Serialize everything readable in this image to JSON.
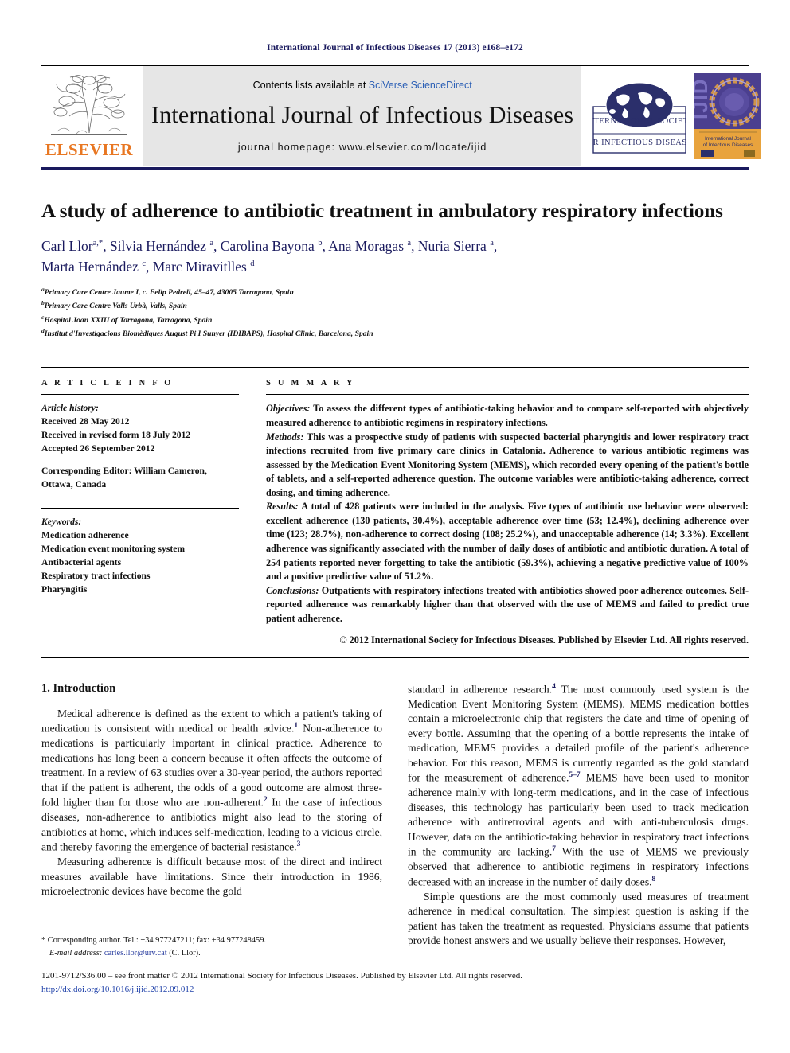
{
  "running_head": "International Journal of Infectious Diseases 17 (2013) e168–e172",
  "masthead": {
    "elsevier_wordmark": "ELSEVIER",
    "contents_prefix": "Contents lists available at ",
    "sciencedirect_link": "SciVerse ScienceDirect",
    "journal_title": "International Journal of Infectious Diseases",
    "homepage_line": "journal homepage: www.elsevier.com/locate/ijid",
    "isid_line1": "INTERNATIONAL SOCIETY",
    "isid_line2": "FOR INFECTIOUS DISEASES",
    "cover_spine": "IJID",
    "cover_title_line1": "International Journal",
    "cover_title_line2": "of Infectious Diseases",
    "accent_orange": "#E87722",
    "accent_navy": "#1a1a5e",
    "band_gray": "#e6e6e6"
  },
  "article": {
    "title": "A study of adherence to antibiotic treatment in ambulatory respiratory infections",
    "authors_line1_html": "Carl Llor<sup>a,*</sup>, Silvia Hernández <sup>a</sup>, Carolina Bayona <sup>b</sup>, Ana Moragas <sup>a</sup>, Nuria Sierra <sup>a</sup>,",
    "authors_line2_html": "Marta Hernández <sup>c</sup>, Marc Miravitlles <sup>d</sup>",
    "affiliations": [
      "Primary Care Centre Jaume I, c. Felip Pedrell, 45–47, 43005 Tarragona, Spain",
      "Primary Care Centre Valls Urbà, Valls, Spain",
      "Hospital Joan XXIII of Tarragona, Tarragona, Spain",
      "Institut d'Investigacions Biomèdiques August Pi I Sunyer (IDIBAPS), Hospital Clinic, Barcelona, Spain"
    ],
    "affiliation_markers": [
      "a",
      "b",
      "c",
      "d"
    ]
  },
  "article_info": {
    "heading": "A R T I C L E   I N F O",
    "history_label": "Article history:",
    "history": [
      "Received 28 May 2012",
      "Received in revised form 18 July 2012",
      "Accepted 26 September 2012"
    ],
    "corresponding_editor_label": "Corresponding Editor:",
    "corresponding_editor_value": " William Cameron, Ottawa, Canada",
    "keywords_label": "Keywords:",
    "keywords": [
      "Medication adherence",
      "Medication event monitoring system",
      "Antibacterial agents",
      "Respiratory tract infections",
      "Pharyngitis"
    ]
  },
  "summary": {
    "heading": "S U M M A R Y",
    "objectives_label": "Objectives:",
    "objectives_text": " To assess the different types of antibiotic-taking behavior and to compare self-reported with objectively measured adherence to antibiotic regimens in respiratory infections.",
    "methods_label": "Methods:",
    "methods_text": " This was a prospective study of patients with suspected bacterial pharyngitis and lower respiratory tract infections recruited from five primary care clinics in Catalonia. Adherence to various antibiotic regimens was assessed by the Medication Event Monitoring System (MEMS), which recorded every opening of the patient's bottle of tablets, and a self-reported adherence question. The outcome variables were antibiotic-taking adherence, correct dosing, and timing adherence.",
    "results_label": "Results:",
    "results_text": " A total of 428 patients were included in the analysis. Five types of antibiotic use behavior were observed: excellent adherence (130 patients, 30.4%), acceptable adherence over time (53; 12.4%), declining adherence over time (123; 28.7%), non-adherence to correct dosing (108; 25.2%), and unacceptable adherence (14; 3.3%). Excellent adherence was significantly associated with the number of daily doses of antibiotic and antibiotic duration. A total of 254 patients reported never forgetting to take the antibiotic (59.3%), achieving a negative predictive value of 100% and a positive predictive value of 51.2%.",
    "conclusions_label": "Conclusions:",
    "conclusions_text": " Outpatients with respiratory infections treated with antibiotics showed poor adherence outcomes. Self-reported adherence was remarkably higher than that observed with the use of MEMS and failed to predict true patient adherence.",
    "copyright": "© 2012 International Society for Infectious Diseases. Published by Elsevier Ltd. All rights reserved."
  },
  "body": {
    "section_heading": "1. Introduction",
    "left_p1_a": "Medical adherence is defined as the extent to which a patient's taking of medication is consistent with medical or health advice.",
    "left_p1_ref1": "1",
    "left_p1_b": " Non-adherence to medications is particularly important in clinical practice. Adherence to medications has long been a concern because it often affects the outcome of treatment. In a review of 63 studies over a 30-year period, the authors reported that if the patient is adherent, the odds of a good outcome are almost three-fold higher than for those who are non-adherent.",
    "left_p1_ref2": "2",
    "left_p1_c": " In the case of infectious diseases, non-adherence to antibiotics might also lead to the storing of antibiotics at home, which induces self-medication, leading to a vicious circle, and thereby favoring the emergence of bacterial resistance.",
    "left_p1_ref3": "3",
    "left_p2": "Measuring adherence is difficult because most of the direct and indirect measures available have limitations. Since their introduction in 1986, microelectronic devices have become the gold",
    "right_p1_a": "standard in adherence research.",
    "right_p1_ref4": "4",
    "right_p1_b": " The most commonly used system is the Medication Event Monitoring System (MEMS). MEMS medication bottles contain a microelectronic chip that registers the date and time of opening of every bottle. Assuming that the opening of a bottle represents the intake of medication, MEMS provides a detailed profile of the patient's adherence behavior. For this reason, MEMS is currently regarded as the gold standard for the measurement of adherence.",
    "right_p1_ref57": "5–7",
    "right_p1_c": " MEMS have been used to monitor adherence mainly with long-term medications, and in the case of infectious diseases, this technology has particularly been used to track medication adherence with antiretroviral agents and with anti-tuberculosis drugs. However, data on the antibiotic-taking behavior in respiratory tract infections in the community are lacking.",
    "right_p1_ref7": "7",
    "right_p1_d": " With the use of MEMS we previously observed that adherence to antibiotic regimens in respiratory infections decreased with an increase in the number of daily doses.",
    "right_p1_ref8": "8",
    "right_p2": "Simple questions are the most commonly used measures of treatment adherence in medical consultation. The simplest question is asking if the patient has taken the treatment as requested. Physicians assume that patients provide honest answers and we usually believe their responses. However,"
  },
  "footnote": {
    "marker": "*",
    "corresponding_text": " Corresponding author. Tel.: +34 977247211; fax: +34 977248459.",
    "email_label": "E-mail address:",
    "email_value": "carles.llor@urv.cat",
    "email_suffix": " (C. Llor)."
  },
  "footer": {
    "front_matter": "1201-9712/$36.00 – see front matter © 2012 International Society for Infectious Diseases. Published by Elsevier Ltd. All rights reserved.",
    "doi": "http://dx.doi.org/10.1016/j.ijid.2012.09.012"
  }
}
